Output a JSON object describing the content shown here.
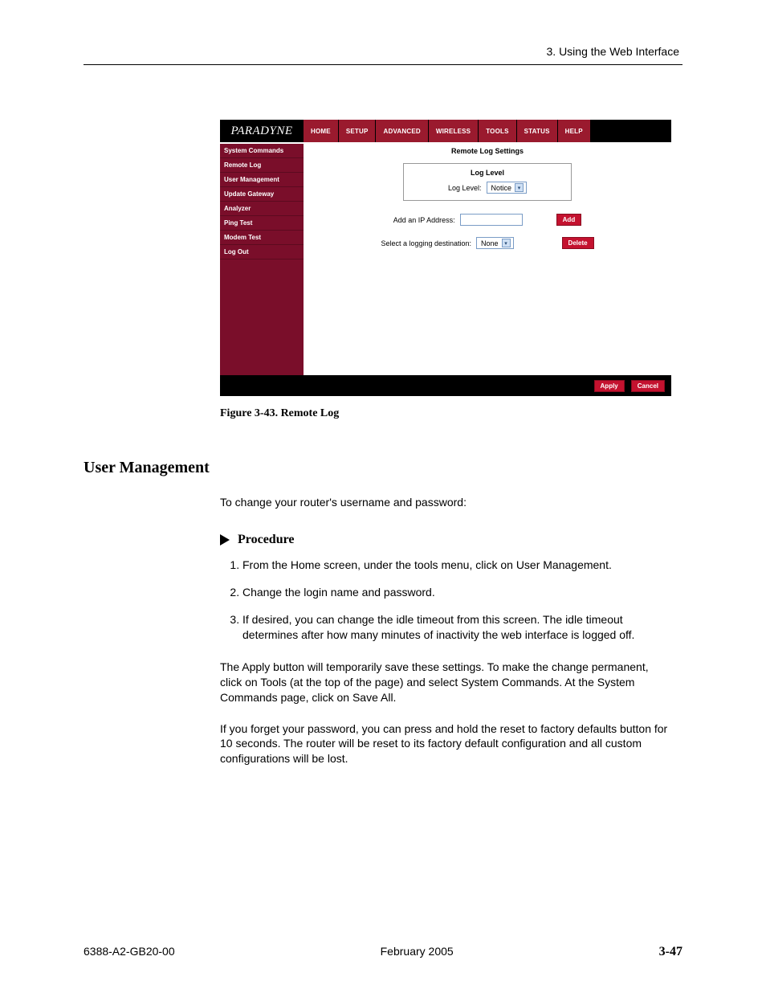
{
  "header": {
    "running_head": "3. Using the Web Interface"
  },
  "router": {
    "brand": "PARADYNE",
    "tabs": [
      "HOME",
      "SETUP",
      "ADVANCED",
      "WIRELESS",
      "TOOLS",
      "STATUS",
      "HELP"
    ],
    "sidebar": [
      "System Commands",
      "Remote Log",
      "User Management",
      "Update Gateway",
      "Analyzer",
      "Ping Test",
      "Modem Test",
      "Log Out"
    ],
    "content": {
      "title": "Remote Log Settings",
      "loglevel_box_title": "Log Level",
      "loglevel_label": "Log Level:",
      "loglevel_value": "Notice",
      "add_ip_label": "Add an IP Address:",
      "add_ip_value": "",
      "add_button": "Add",
      "select_dest_label": "Select a logging destination:",
      "select_dest_value": "None",
      "delete_button": "Delete",
      "apply_button": "Apply",
      "cancel_button": "Cancel"
    }
  },
  "figure": {
    "caption": "Figure 3-43.   Remote Log"
  },
  "section": {
    "heading": "User Management",
    "intro": "To change your router's username and password:",
    "procedure_label": "Procedure",
    "steps": [
      "From the Home screen, under the tools menu, click on User Management.",
      "Change the login name and password.",
      "If desired, you can change the idle timeout from this screen. The idle timeout determines after how many minutes of inactivity the web interface is logged off."
    ],
    "para_apply": "The Apply button will temporarily save these settings. To make the change permanent,  click on Tools (at the top of the page) and select System Commands. At the System Commands page, click on Save All.",
    "para_forgot": "If you forget your password, you can press and hold the reset to factory defaults button for 10 seconds. The router will be reset to its factory default configuration and all custom configurations will be lost."
  },
  "footer": {
    "doc_id": "6388-A2-GB20-00",
    "date": "February 2005",
    "page": "3-47"
  }
}
